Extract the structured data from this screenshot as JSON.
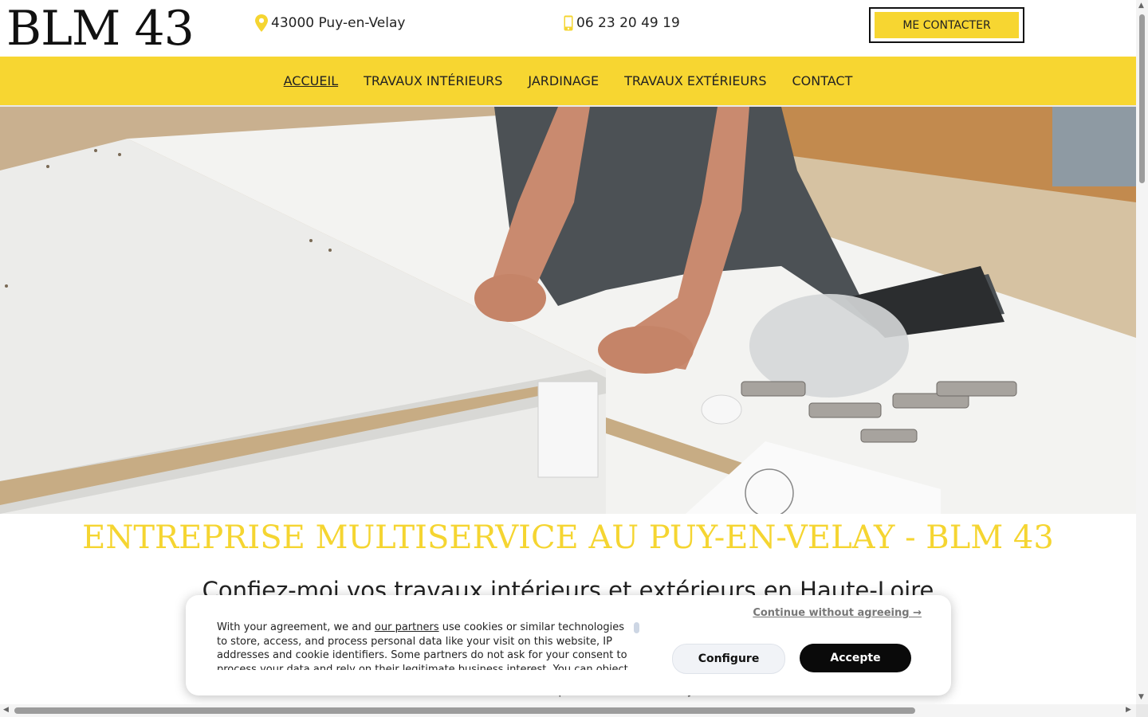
{
  "header": {
    "logo": "BLM 43",
    "address": "43000 Puy-en-Velay",
    "phone": "06 23 20 49 19",
    "contact_button": "ME CONTACTER",
    "pin_icon": "map-pin-icon",
    "phone_icon": "mobile-phone-icon"
  },
  "nav": {
    "items": [
      {
        "label": "ACCUEIL",
        "active": true
      },
      {
        "label": "TRAVAUX INTÉRIEURS",
        "active": false
      },
      {
        "label": "JARDINAGE",
        "active": false
      },
      {
        "label": "TRAVAUX EXTÉRIEURS",
        "active": false
      },
      {
        "label": "CONTACT",
        "active": false
      }
    ]
  },
  "main": {
    "headline": "ENTREPRISE MULTISERVICE AU PUY-EN-VELAY - BLM 43",
    "subheadline": "Confiez-moi vos travaux intérieurs et extérieurs en Haute-Loire",
    "partial_text": "p      travaux de votre jardin"
  },
  "cookie_banner": {
    "text_before_link": "With your agreement, we and ",
    "link": "our partners",
    "text_after_link": " use cookies or similar technologies to store, access, and process personal data like your visit on this website, IP addresses and cookie identifiers. Some partners do not ask for your consent to process your data and rely on their legitimate business interest. You can object to those data processing by clicking on \"Learn More\".",
    "continue": "Continue without agreeing →",
    "configure": "Configure",
    "accept": "Accepte"
  },
  "colors": {
    "brand_yellow": "#f7d631",
    "headline_yellow": "#f5d531",
    "accept_bg": "#0a0a0a"
  }
}
